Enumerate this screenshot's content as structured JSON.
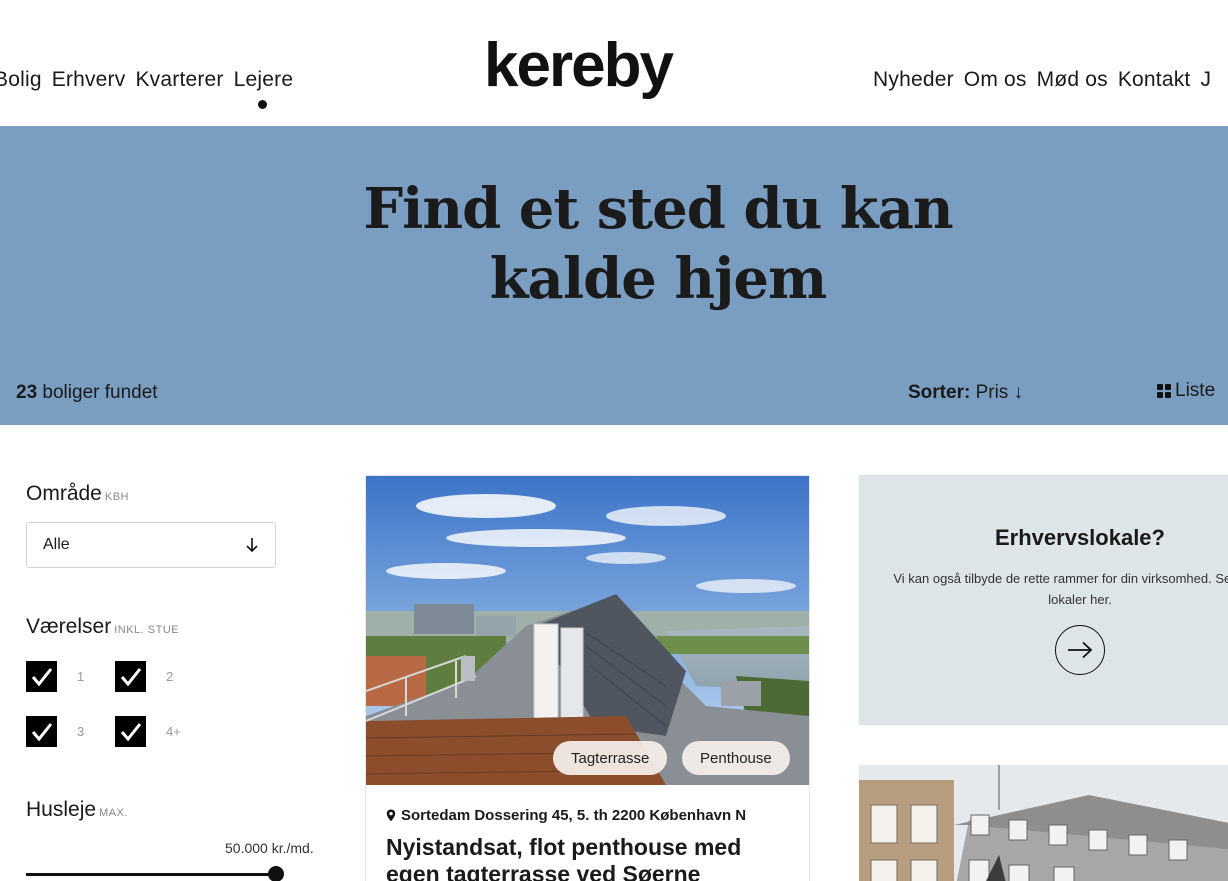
{
  "nav": {
    "left": [
      "Bolig",
      "Erhverv",
      "Kvarterer",
      "Lejere"
    ],
    "right": [
      "Nyheder",
      "Om os",
      "Mød os",
      "Kontakt",
      "J"
    ]
  },
  "logo": "kereby",
  "hero": {
    "title_line1": "Find et sted du kan",
    "title_line2": "kalde hjem",
    "results_count": "23",
    "results_text": "boliger fundet",
    "sort_label": "Sorter:",
    "sort_value": "Pris ↓",
    "view_label": "Liste"
  },
  "filters": {
    "area": {
      "title": "Område",
      "sub": "KBH",
      "value": "Alle"
    },
    "rooms": {
      "title": "Værelser",
      "sub": "INKL. STUE",
      "options": [
        {
          "label": "1",
          "checked": true
        },
        {
          "label": "2",
          "checked": true
        },
        {
          "label": "3",
          "checked": true
        },
        {
          "label": "4+",
          "checked": true
        }
      ]
    },
    "rent": {
      "title": "Husleje",
      "sub": "MAX.",
      "value": "50.000 kr./md.",
      "level": 1.0
    }
  },
  "listing": {
    "tags": [
      "Tagterrasse",
      "Penthouse"
    ],
    "address": "Sortedam Dossering 45, 5. th 2200 København N",
    "title": "Nyistandsat, flot penthouse med egen tagterrasse ved Søerne"
  },
  "promo": {
    "title": "Erhvervslokale?",
    "text": "Vi kan også tilbyde de rette rammer for din virksomhed. Se vores lokaler her."
  },
  "colors": {
    "hero_bg": "#7a9ec2",
    "promo_bg": "#dde5e9",
    "text": "#1a1a1a"
  }
}
